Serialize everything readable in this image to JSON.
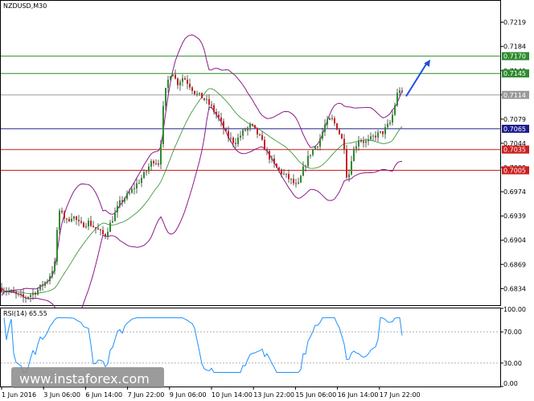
{
  "chart_data": {
    "type": "candlestick",
    "symbol": "NZDUSD,M30",
    "price_axis": {
      "ylim": [
        0.681,
        0.725
      ],
      "ticks": [
        "0.7219",
        "0.7184",
        "0.7149",
        "0.7114",
        "0.7079",
        "0.7044",
        "0.7009",
        "0.6974",
        "0.6939",
        "0.6904",
        "0.6869",
        "0.6834"
      ]
    },
    "levels": [
      {
        "value": 0.717,
        "label": "0.7170",
        "color": "#2e8b2e"
      },
      {
        "value": 0.7145,
        "label": "0.7145",
        "color": "#2e8b2e"
      },
      {
        "value": 0.7114,
        "label": "0.7114",
        "color": "#9a9a9a"
      },
      {
        "value": 0.7065,
        "label": "0.7065",
        "color": "#1c1c8c"
      },
      {
        "value": 0.7035,
        "label": "0.7035",
        "color": "#cc1f1f"
      },
      {
        "value": 0.7005,
        "label": "0.7005",
        "color": "#cc1f1f"
      }
    ],
    "price_path": [
      [
        0,
        0.6835
      ],
      [
        15,
        0.6828
      ],
      [
        30,
        0.682
      ],
      [
        45,
        0.683
      ],
      [
        60,
        0.6848
      ],
      [
        68,
        0.687
      ],
      [
        72,
        0.6935
      ],
      [
        76,
        0.695
      ],
      [
        82,
        0.693
      ],
      [
        90,
        0.694
      ],
      [
        100,
        0.6925
      ],
      [
        110,
        0.693
      ],
      [
        120,
        0.692
      ],
      [
        130,
        0.691
      ],
      [
        140,
        0.6935
      ],
      [
        150,
        0.696
      ],
      [
        160,
        0.697
      ],
      [
        170,
        0.6985
      ],
      [
        180,
        0.7
      ],
      [
        190,
        0.702
      ],
      [
        198,
        0.7015
      ],
      [
        204,
        0.711
      ],
      [
        210,
        0.714
      ],
      [
        214,
        0.715
      ],
      [
        220,
        0.713
      ],
      [
        228,
        0.714
      ],
      [
        236,
        0.7128
      ],
      [
        244,
        0.7115
      ],
      [
        252,
        0.711
      ],
      [
        262,
        0.7098
      ],
      [
        272,
        0.708
      ],
      [
        282,
        0.7055
      ],
      [
        292,
        0.7045
      ],
      [
        302,
        0.706
      ],
      [
        312,
        0.707
      ],
      [
        322,
        0.7055
      ],
      [
        332,
        0.703
      ],
      [
        342,
        0.701
      ],
      [
        352,
        0.7
      ],
      [
        362,
        0.699
      ],
      [
        370,
        0.698
      ],
      [
        378,
        0.701
      ],
      [
        386,
        0.703
      ],
      [
        396,
        0.7045
      ],
      [
        404,
        0.707
      ],
      [
        412,
        0.708
      ],
      [
        420,
        0.7065
      ],
      [
        428,
        0.704
      ],
      [
        432,
        0.6985
      ],
      [
        438,
        0.703
      ],
      [
        446,
        0.705
      ],
      [
        456,
        0.7045
      ],
      [
        466,
        0.7055
      ],
      [
        476,
        0.706
      ],
      [
        486,
        0.7075
      ],
      [
        492,
        0.7105
      ],
      [
        496,
        0.7125
      ],
      [
        500,
        0.7115
      ]
    ],
    "forecast_arrow": {
      "from": [
        505,
        0.7112
      ],
      "to": [
        535,
        0.7165
      ],
      "color": "#1f4fe0"
    },
    "rsi": {
      "label": "RSI(14) 65.55",
      "period": 14,
      "value": 65.55,
      "ylim": [
        0,
        100
      ],
      "ticks": [
        "100.00",
        "70.00",
        "30.00",
        "0.00"
      ],
      "levels": [
        70,
        30
      ],
      "color": "#1e90ff"
    },
    "time_axis": {
      "labels": [
        "1 Jun 2016",
        "3 Jun 06:00",
        "6 Jun 14:00",
        "7 Jun 22:00",
        "9 Jun 06:00",
        "10 Jun 14:00",
        "13 Jun 22:00",
        "15 Jun 06:00",
        "16 Jun 14:00",
        "17 Jun 22:00"
      ]
    },
    "watermark": "www.instaforex.com",
    "colors": {
      "candle_up": "#2e8b2e",
      "candle_down": "#cc1f1f",
      "wick": "#333333",
      "bollinger": "#8b1a8b",
      "ma": "#2e8b2e"
    }
  }
}
